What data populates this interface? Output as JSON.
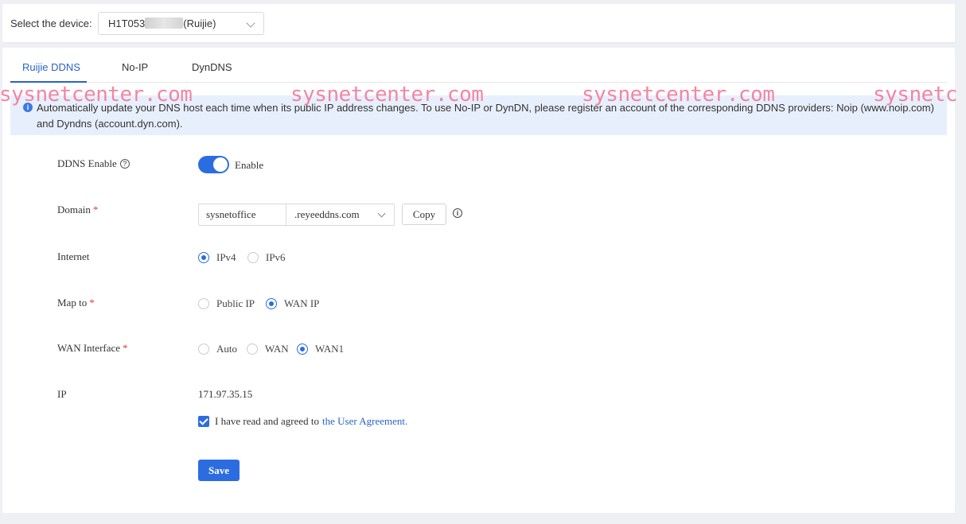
{
  "device_selector": {
    "label": "Select the device:",
    "value_prefix": "H1T053",
    "value_suffix": "(Ruijie)"
  },
  "tabs": [
    {
      "label": "Ruijie DDNS",
      "active": true
    },
    {
      "label": "No-IP",
      "active": false
    },
    {
      "label": "DynDNS",
      "active": false
    }
  ],
  "watermark": "sysnetcenter.com",
  "watermark_partial": "sysnetc",
  "notice": {
    "text": "Automatically update your DNS host each time when its public IP address changes. To use No-IP or DynDN, please register an account of the corresponding DDNS providers: Noip (www.noip.com) and Dyndns (account.dyn.com)."
  },
  "form": {
    "ddns_enable": {
      "label": "DDNS Enable",
      "toggle_text": "Enable",
      "enabled": true
    },
    "domain": {
      "label": "Domain",
      "value": "sysnetoffice",
      "suffix": ".reyeeddns.com",
      "copy_label": "Copy"
    },
    "internet": {
      "label": "Internet",
      "options": [
        "IPv4",
        "IPv6"
      ],
      "selected": "IPv4"
    },
    "map_to": {
      "label": "Map to",
      "options": [
        "Public IP",
        "WAN IP"
      ],
      "selected": "WAN IP"
    },
    "wan_interface": {
      "label": "WAN Interface",
      "options": [
        "Auto",
        "WAN",
        "WAN1"
      ],
      "selected": "WAN1"
    },
    "ip": {
      "label": "IP",
      "value": "171.97.35.15"
    },
    "agreement": {
      "text": "I have read and agreed to",
      "link": "the User Agreement.",
      "checked": true
    },
    "save_label": "Save"
  },
  "colors": {
    "accent": "#2b6de0",
    "required": "#e23a3a",
    "watermark": "#f27a9a",
    "notice_bg": "#e8effc"
  }
}
